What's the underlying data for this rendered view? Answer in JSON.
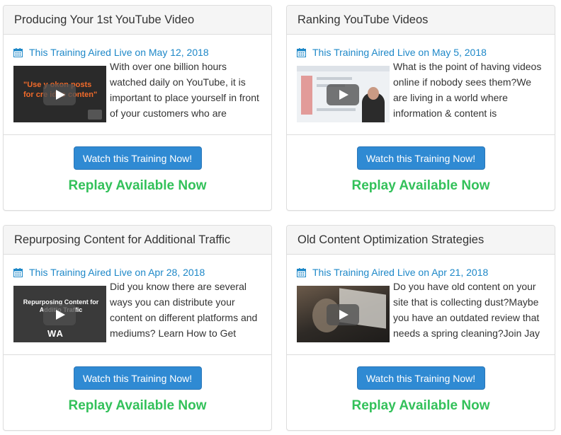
{
  "accent_colors": {
    "link": "#1e88c8",
    "button": "#2f8ad3",
    "replay": "#33c15a"
  },
  "cards": [
    {
      "title": "Producing Your 1st YouTube Video",
      "date_text": "This Training Aired Live on May 12, 2018",
      "thumb_text": "\"Use y    okon posts for cre    ideo conten\"",
      "description": "With over one billion hours watched daily on YouTube, it is important to place yourself in front of your customers who are",
      "button_label": "Watch this Training Now!",
      "status": "Replay Available Now"
    },
    {
      "title": "Ranking YouTube Videos",
      "date_text": "This Training Aired Live on May 5, 2018",
      "description": "What is the point of having videos online if nobody sees them?We are living in a world where information & content is",
      "button_label": "Watch this Training Now!",
      "status": "Replay Available Now"
    },
    {
      "title": "Repurposing Content for Additional Traffic",
      "date_text": "This Training Aired Live on Apr 28, 2018",
      "thumb_text": "Repurposing Content for Additio     Traffic",
      "thumb_logo": "WA",
      "description": "Did you know there are several ways you can distribute your content on different platforms and mediums? Learn How to Get",
      "button_label": "Watch this Training Now!",
      "status": "Replay Available Now"
    },
    {
      "title": "Old Content Optimization Strategies",
      "date_text": "This Training Aired Live on Apr 21, 2018",
      "description": "Do you have old content on your site that is collecting dust?Maybe you have an outdated review that needs a spring cleaning?Join Jay",
      "button_label": "Watch this Training Now!",
      "status": "Replay Available Now"
    }
  ]
}
